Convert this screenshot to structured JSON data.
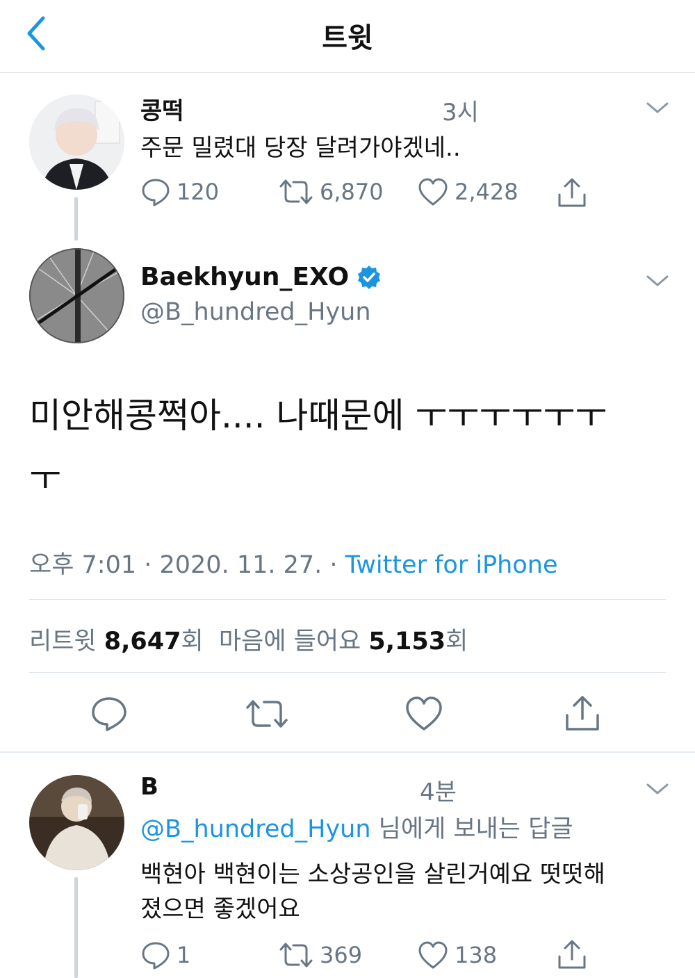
{
  "header": {
    "title": "트윗"
  },
  "tweet1": {
    "name": "콩떡",
    "time": "3시",
    "text": "주문 밀렸대 당장 달려가야겠네..",
    "reply_count": "120",
    "retweet_count": "6,870",
    "like_count": "2,428"
  },
  "main": {
    "name": "Baekhyun_EXO",
    "handle": "@B_hundred_Hyun",
    "text_line1": "미안해콩쩍아.... 나때문에 ㅜㅜㅜㅜㅜㅜ",
    "text_line2": "ㅜ",
    "timestamp": "오후 7:01 · 2020. 11. 27. · ",
    "source": "Twitter for iPhone",
    "retweets_label": "리트윗 ",
    "retweets_count": "8,647",
    "retweets_suffix": "회",
    "likes_label": "마음에 들어요 ",
    "likes_count": "5,153",
    "likes_suffix": "회"
  },
  "reply": {
    "name": "B",
    "time": "4분",
    "mention": "@B_hundred_Hyun",
    "mention_suffix": " 님에게 보내는 답글",
    "text_line1": "백현아 백현이는 소상공인을 살린거예요 떳떳해",
    "text_line2": "졌으면 좋겠어요",
    "reply_count": "1",
    "retweet_count": "369",
    "like_count": "138"
  },
  "colors": {
    "accent": "#1b95e0",
    "muted": "#687684",
    "text": "#111111"
  }
}
